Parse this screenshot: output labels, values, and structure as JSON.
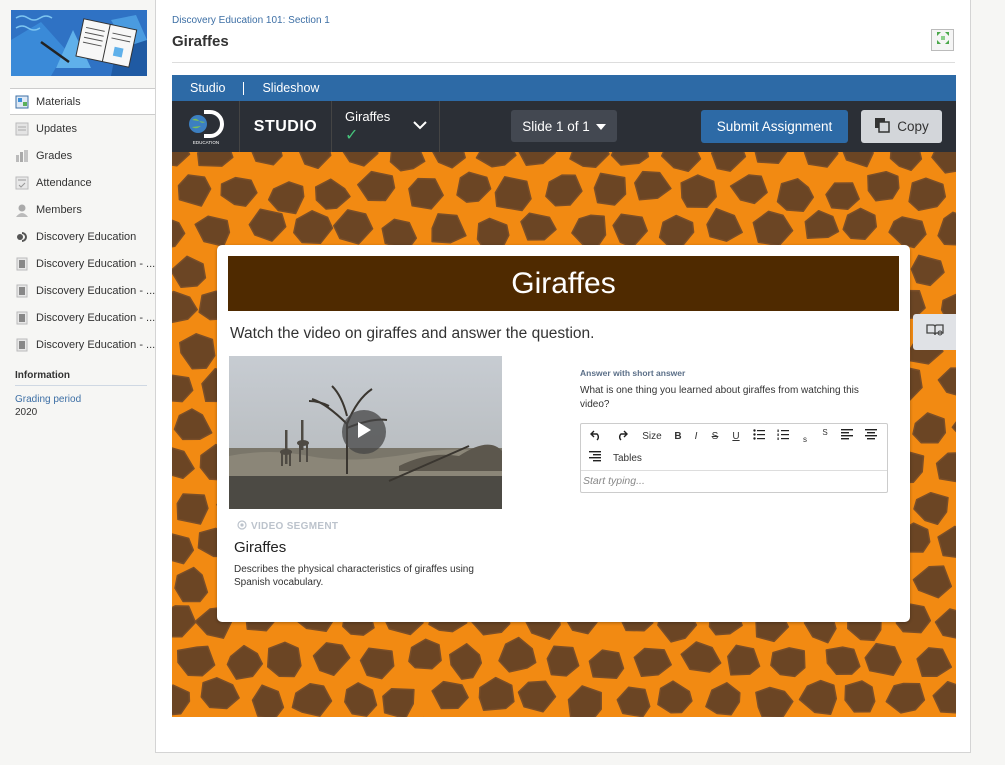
{
  "sidebar": {
    "items": [
      {
        "label": "Materials",
        "icon": "materials-icon",
        "active": true
      },
      {
        "label": "Updates",
        "icon": "updates-icon"
      },
      {
        "label": "Grades",
        "icon": "grades-icon"
      },
      {
        "label": "Attendance",
        "icon": "attendance-icon"
      },
      {
        "label": "Members",
        "icon": "members-icon"
      },
      {
        "label": "Discovery Education",
        "icon": "discovery-logo-icon"
      },
      {
        "label": "Discovery Education - ...",
        "icon": "app-icon"
      },
      {
        "label": "Discovery Education - ...",
        "icon": "app-icon"
      },
      {
        "label": "Discovery Education - ...",
        "icon": "app-icon"
      },
      {
        "label": "Discovery Education - ...",
        "icon": "app-icon"
      }
    ],
    "information": {
      "heading": "Information",
      "grading_label": "Grading period",
      "grading_value": "2020"
    }
  },
  "header": {
    "breadcrumb": "Discovery Education 101: Section 1",
    "title": "Giraffes"
  },
  "studio": {
    "tabs": [
      "Studio",
      "Slideshow"
    ],
    "logo_text": "EDUCATION",
    "studio_label": "STUDIO",
    "project_name": "Giraffes",
    "project_check": "✓",
    "slide_indicator": "Slide 1 of 1",
    "submit_label": "Submit Assignment",
    "copy_label": "Copy"
  },
  "slide": {
    "title": "Giraffes",
    "instruction": "Watch the video on giraffes and answer the question.",
    "video": {
      "segment_label": "VIDEO SEGMENT",
      "title": "Giraffes",
      "description": "Describes the physical characteristics of giraffes using Spanish vocabulary."
    },
    "question": {
      "label": "Answer with short answer",
      "text": "What is one thing you learned about giraffes from watching this video?",
      "placeholder": "Start typing...",
      "toolbar": {
        "size": "Size",
        "bold": "B",
        "italic": "I",
        "strike": "S",
        "underline": "U",
        "subscript": "s",
        "superscript": "S",
        "tables": "Tables"
      }
    }
  },
  "colors": {
    "tab_bar": "#2d6aa6",
    "studio_bar": "#2b2f36",
    "title_band": "#4f2a00",
    "giraffe_orange": "#f28a12",
    "giraffe_patch": "#6b4524",
    "check_green": "#45c27b"
  }
}
